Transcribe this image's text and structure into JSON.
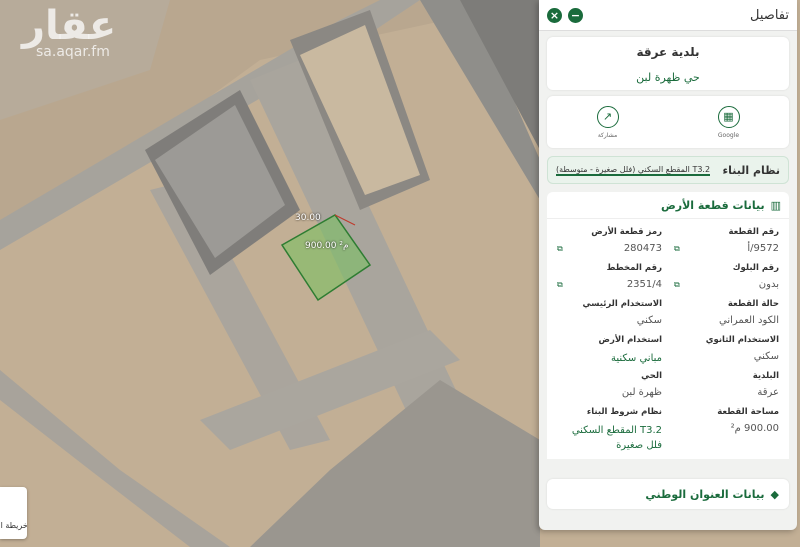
{
  "watermark": {
    "logo": "عقار",
    "site": "sa.aqar.fm"
  },
  "map": {
    "parcel_area_label": "900.00 م²",
    "parcel_dim_label": "30.00",
    "chip_label": "خريطة الأ"
  },
  "panel": {
    "title": "تفاصيل",
    "municipality": "بلدية عرقة",
    "district": "حي ظهرة لبن",
    "actions": [
      {
        "label": "Google",
        "icon": "map-icon"
      },
      {
        "label": "مشاركة",
        "icon": "share-icon"
      }
    ],
    "building_system": {
      "key": "نظام البناء",
      "value": "T3.2 المقطع السكني (فلل صغيرة - متوسطة)"
    },
    "land_section_title": "بيانات قطعة الأرض",
    "fields": [
      {
        "label": "رقم القطعة",
        "value": "9572/أ"
      },
      {
        "label": "رمز قطعة الأرض",
        "value": "280473"
      },
      {
        "label": "رقم البلوك",
        "value": "بدون"
      },
      {
        "label": "رقم المخطط",
        "value": "2351/4"
      },
      {
        "label": "حالة القطعة",
        "value": "الكود العمراني"
      },
      {
        "label": "الاستخدام الرئيسي",
        "value": "سكني"
      },
      {
        "label": "الاستخدام الثانوي",
        "value": "سكني"
      },
      {
        "label": "استخدام الأرض",
        "value": "مباني سكنية"
      },
      {
        "label": "البلدية",
        "value": "عرقة"
      },
      {
        "label": "الحي",
        "value": "ظهرة لبن"
      },
      {
        "label": "مساحة القطعة",
        "value": "900.00 م²"
      },
      {
        "label": "نظام شروط البناء",
        "value": "T3.2 المقطع السكني فلل صغيرة"
      }
    ],
    "address_title": "بيانات العنوان الوطني"
  },
  "colors": {
    "accent": "#1a6b3c"
  }
}
